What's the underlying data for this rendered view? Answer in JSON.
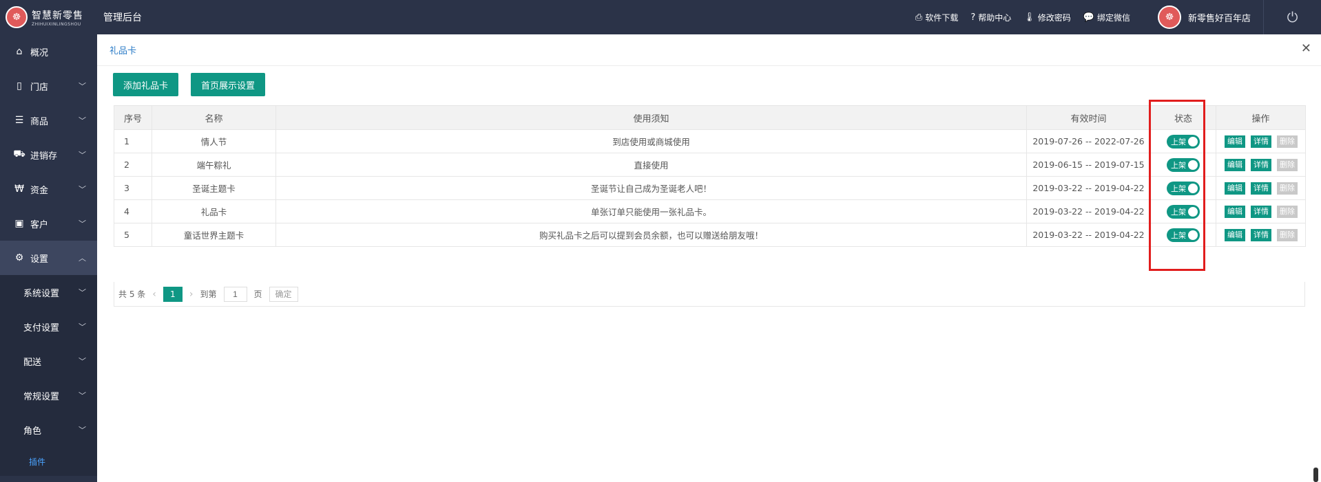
{
  "topbar": {
    "logo_cn": "智慧新零售",
    "logo_en": "ZHIHUIXINLINGSHOU",
    "logo_icon": "seal-logo-icon",
    "admin_title": "管理后台",
    "links": [
      {
        "icon": "printer-icon",
        "label": "软件下载"
      },
      {
        "icon": "help-circle-icon",
        "label": "帮助中心"
      },
      {
        "icon": "thermometer-icon",
        "label": "修改密码"
      },
      {
        "icon": "chat-icon",
        "label": "绑定微信"
      }
    ],
    "store_name": "新零售好百年店",
    "power_icon": "power-icon"
  },
  "sidebar": {
    "items": [
      {
        "icon": "home-icon",
        "label": "概况"
      },
      {
        "icon": "building-icon",
        "label": "门店"
      },
      {
        "icon": "list-icon",
        "label": "商品"
      },
      {
        "icon": "truck-icon",
        "label": "进销存"
      },
      {
        "icon": "won-icon",
        "label": "资金"
      },
      {
        "icon": "id-card-icon",
        "label": "客户"
      },
      {
        "icon": "gear-icon",
        "label": "设置"
      }
    ],
    "sub_items": [
      {
        "label": "系统设置"
      },
      {
        "label": "支付设置"
      },
      {
        "label": "配送"
      },
      {
        "label": "常规设置"
      },
      {
        "label": "角色"
      }
    ],
    "plugin_label": "插件"
  },
  "tab": {
    "title": "礼品卡"
  },
  "buttons": {
    "add": "添加礼品卡",
    "homepage": "首页展示设置"
  },
  "table": {
    "headers": [
      "序号",
      "名称",
      "使用须知",
      "有效时间",
      "状态",
      "操作"
    ],
    "rows": [
      {
        "no": "1",
        "name": "情人节",
        "notice": "到店使用或商城使用",
        "time": "2019-07-26 -- 2022-07-26",
        "status": "上架"
      },
      {
        "no": "2",
        "name": "端午粽礼",
        "notice": "直接使用",
        "time": "2019-06-15 -- 2019-07-15",
        "status": "上架"
      },
      {
        "no": "3",
        "name": "圣诞主题卡",
        "notice": "圣诞节让自己成为圣诞老人吧！",
        "time": "2019-03-22 -- 2019-04-22",
        "status": "上架"
      },
      {
        "no": "4",
        "name": "礼品卡",
        "notice": "单张订单只能使用一张礼品卡。",
        "time": "2019-03-22 -- 2019-04-22",
        "status": "上架"
      },
      {
        "no": "5",
        "name": "童话世界主题卡",
        "notice": "购买礼品卡之后可以提到会员余额，也可以赠送给朋友哦！",
        "time": "2019-03-22 -- 2019-04-22",
        "status": "上架"
      }
    ],
    "actions": {
      "edit": "编辑",
      "detail": "详情",
      "delete": "删除"
    }
  },
  "pager": {
    "total": "共 5 条",
    "current": "1",
    "goto_label": "到第",
    "goto_value": "1",
    "page_label": "页",
    "confirm": "确定"
  },
  "colors": {
    "sidebar": "#2b3348",
    "accent": "#0f9784",
    "highlight": "#e11d1d"
  }
}
